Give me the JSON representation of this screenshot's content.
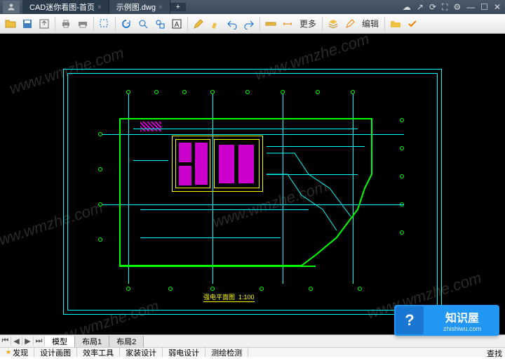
{
  "titlebar": {
    "tabs": [
      {
        "label": "CAD迷你看图-首页",
        "active": false
      },
      {
        "label": "示例图.dwg",
        "active": true
      }
    ],
    "new_tab": "+"
  },
  "toolbar": {
    "more": "更多",
    "edit": "编辑"
  },
  "drawing": {
    "title_text": "强电平面图",
    "scale": "1:100"
  },
  "watermark_text": "www.wmzhe.com",
  "sheet_tabs": {
    "nav": [
      "⏮",
      "◀",
      "▶",
      "⏭"
    ],
    "items": [
      "模型",
      "布局1",
      "布局2"
    ]
  },
  "bottom_tabs": {
    "items": [
      "发现",
      "设计画图",
      "效率工具",
      "家装设计",
      "弱电设计",
      "测绘检测"
    ],
    "truncated": "查找"
  },
  "brand": {
    "cn": "知识屋",
    "en": "zhishiwu.com",
    "icon": "?"
  }
}
